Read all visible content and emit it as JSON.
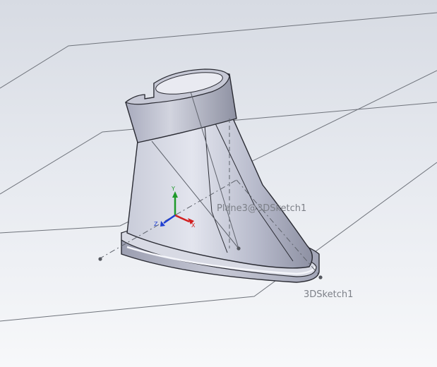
{
  "viewport": {
    "labels": {
      "plane_label": "Plane3@3DSketch1",
      "sketch_label": "3DSketch1"
    },
    "triad": {
      "x_label": "X",
      "y_label": "Y",
      "z_label": "Z"
    },
    "colors": {
      "background_top": "#d7dbe3",
      "background_bottom": "#f7f8fa",
      "part_body": "#b9bccc",
      "part_edge": "#2a2b33",
      "plane_lines": "#6f737b",
      "axis_x": "#d21f1f",
      "axis_y": "#1f9a2a",
      "axis_z": "#1f3fd2"
    }
  }
}
